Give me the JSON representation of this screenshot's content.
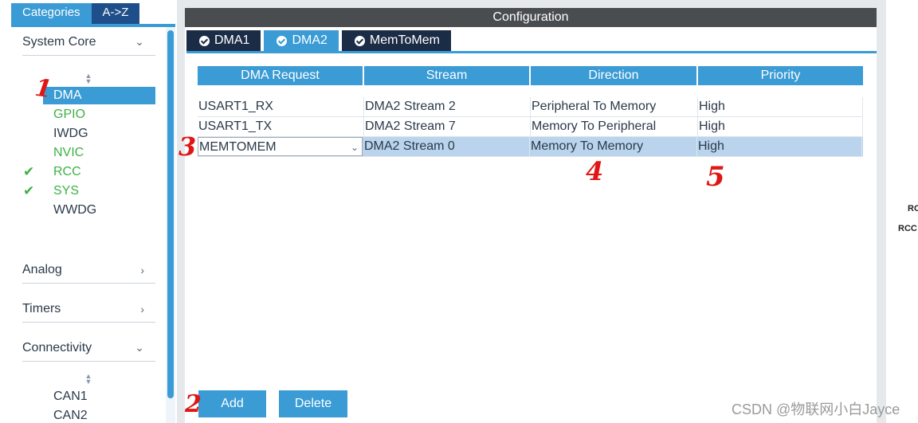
{
  "categories_panel": {
    "tabs": [
      {
        "label": "Categories",
        "active": true
      },
      {
        "label": "A->Z",
        "active": false
      }
    ],
    "system_core": {
      "label": "System Core",
      "chevron": "chevron-down-icon",
      "items": [
        {
          "label": "DMA",
          "state": "selected"
        },
        {
          "label": "GPIO",
          "state": "green"
        },
        {
          "label": "IWDG",
          "state": "normal"
        },
        {
          "label": "NVIC",
          "state": "green"
        },
        {
          "label": "RCC",
          "state": "checked"
        },
        {
          "label": "SYS",
          "state": "checked"
        },
        {
          "label": "WWDG",
          "state": "normal"
        }
      ]
    },
    "analog": {
      "label": "Analog",
      "chevron": "chevron-right-icon"
    },
    "timers": {
      "label": "Timers",
      "chevron": "chevron-right-icon"
    },
    "connectivity": {
      "label": "Connectivity",
      "chevron": "chevron-down-icon",
      "items": [
        {
          "label": "CAN1"
        },
        {
          "label": "CAN2"
        }
      ]
    }
  },
  "configuration": {
    "title": "Configuration",
    "tabs": [
      {
        "label": "DMA1",
        "active": false
      },
      {
        "label": "DMA2",
        "active": true
      },
      {
        "label": "MemToMem",
        "active": false
      }
    ],
    "table": {
      "headers": [
        "DMA Request",
        "Stream",
        "Direction",
        "Priority"
      ],
      "rows": [
        {
          "request": "USART1_RX",
          "stream": "DMA2 Stream 2",
          "direction": "Peripheral To Memory",
          "priority": "High"
        },
        {
          "request": "USART1_TX",
          "stream": "DMA2 Stream 7",
          "direction": "Memory To Peripheral",
          "priority": "High"
        },
        {
          "request": "MEMTOMEM",
          "stream": "DMA2 Stream 0",
          "direction": "Memory To Memory",
          "priority": "High",
          "selected": true
        }
      ]
    },
    "buttons": {
      "add": "Add",
      "delete": "Delete"
    }
  },
  "annotations": [
    "1",
    "2",
    "3",
    "4",
    "5"
  ],
  "right_edge": {
    "line1": "RC",
    "line2": "RCC"
  },
  "watermark": "CSDN @物联网小白Jayce",
  "colors": {
    "accent": "#3a9bd5",
    "dark_tab": "#1b2c46",
    "title_bar": "#4a4d50",
    "enabled_green": "#3db146",
    "selected_row": "#b9d4ec",
    "annotation_red": "#e01515"
  }
}
